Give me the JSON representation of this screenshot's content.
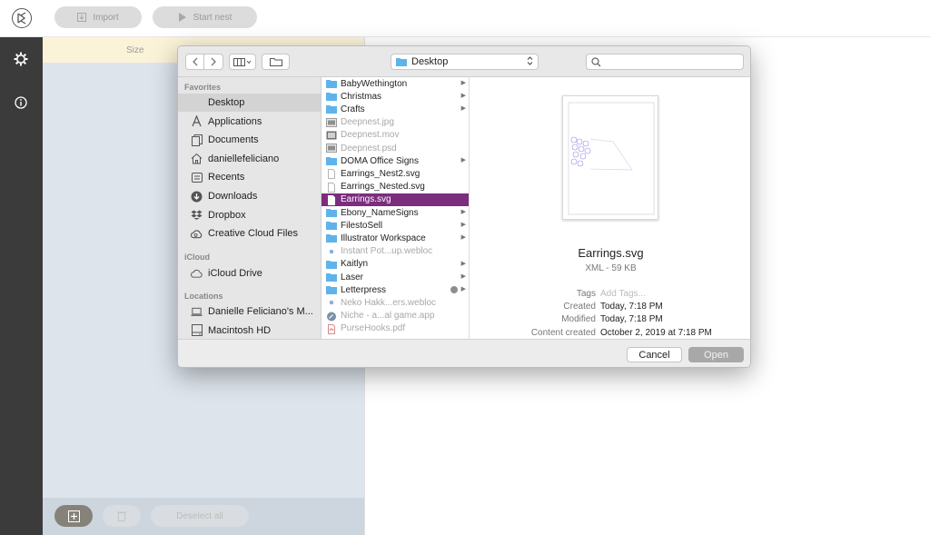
{
  "toolbar": {
    "import_label": "Import",
    "start_nest_label": "Start nest"
  },
  "sidebar": {
    "icons": [
      "gear-icon",
      "info-icon"
    ]
  },
  "parts_panel": {
    "size_header": "Size",
    "deselect_all_label": "Deselect all"
  },
  "dialog": {
    "location": "Desktop",
    "search_placeholder": "",
    "sidebar": {
      "favorites_header": "Favorites",
      "favorites": [
        {
          "label": "Desktop",
          "icon": "desktop-icon",
          "selected": true
        },
        {
          "label": "Applications",
          "icon": "applications-icon"
        },
        {
          "label": "Documents",
          "icon": "documents-icon"
        },
        {
          "label": "daniellefeliciano",
          "icon": "home-icon"
        },
        {
          "label": "Recents",
          "icon": "recents-icon"
        },
        {
          "label": "Downloads",
          "icon": "downloads-icon"
        },
        {
          "label": "Dropbox",
          "icon": "dropbox-icon"
        },
        {
          "label": "Creative Cloud Files",
          "icon": "creative-cloud-icon"
        }
      ],
      "icloud_header": "iCloud",
      "icloud": [
        {
          "label": "iCloud Drive",
          "icon": "cloud-icon"
        }
      ],
      "locations_header": "Locations",
      "locations": [
        {
          "label": "Danielle Feliciano's M...",
          "icon": "laptop-icon"
        },
        {
          "label": "Macintosh HD",
          "icon": "disk-icon"
        }
      ]
    },
    "files": [
      {
        "name": "BabyWethington",
        "kind": "folder",
        "arrow": true
      },
      {
        "name": "Christmas",
        "kind": "folder",
        "arrow": true
      },
      {
        "name": "Crafts",
        "kind": "folder",
        "arrow": true
      },
      {
        "name": "Deepnest.jpg",
        "kind": "image",
        "dim": true
      },
      {
        "name": "Deepnest.mov",
        "kind": "movie",
        "dim": true
      },
      {
        "name": "Deepnest.psd",
        "kind": "image",
        "dim": true
      },
      {
        "name": "DOMA Office Signs",
        "kind": "folder",
        "arrow": true
      },
      {
        "name": "Earrings_Nest2.svg",
        "kind": "doc"
      },
      {
        "name": "Earrings_Nested.svg",
        "kind": "doc"
      },
      {
        "name": "Earrings.svg",
        "kind": "doc",
        "selected": true
      },
      {
        "name": "Ebony_NameSigns",
        "kind": "folder",
        "arrow": true
      },
      {
        "name": "FilestoSell",
        "kind": "folder",
        "arrow": true
      },
      {
        "name": "Illustrator Workspace",
        "kind": "folder",
        "arrow": true
      },
      {
        "name": "Instant Pot...up.webloc",
        "kind": "webloc",
        "dim": true
      },
      {
        "name": "Kaitlyn",
        "kind": "folder",
        "arrow": true
      },
      {
        "name": "Laser",
        "kind": "folder",
        "arrow": true
      },
      {
        "name": "Letterpress",
        "kind": "folder",
        "arrow": true,
        "tag": true
      },
      {
        "name": "Neko Hakk...ers.webloc",
        "kind": "webloc",
        "dim": true
      },
      {
        "name": "Niche - a...al game.app",
        "kind": "app",
        "dim": true
      },
      {
        "name": "PurseHooks.pdf",
        "kind": "pdf",
        "dim": true
      }
    ],
    "preview": {
      "name": "Earrings.svg",
      "kind": "XML - 59 KB",
      "meta": [
        {
          "label": "Tags",
          "value": "Add Tags...",
          "placeholder": true
        },
        {
          "label": "Created",
          "value": "Today, 7:18 PM"
        },
        {
          "label": "Modified",
          "value": "Today, 7:18 PM"
        },
        {
          "label": "Content created",
          "value": "October 2, 2019 at 7:18 PM"
        }
      ]
    },
    "cancel_label": "Cancel",
    "open_label": "Open"
  },
  "colors": {
    "selection": "#7b2d7e",
    "sidebar_dark": "#3b3b3b",
    "folder_blue": "#5fb3ea"
  }
}
